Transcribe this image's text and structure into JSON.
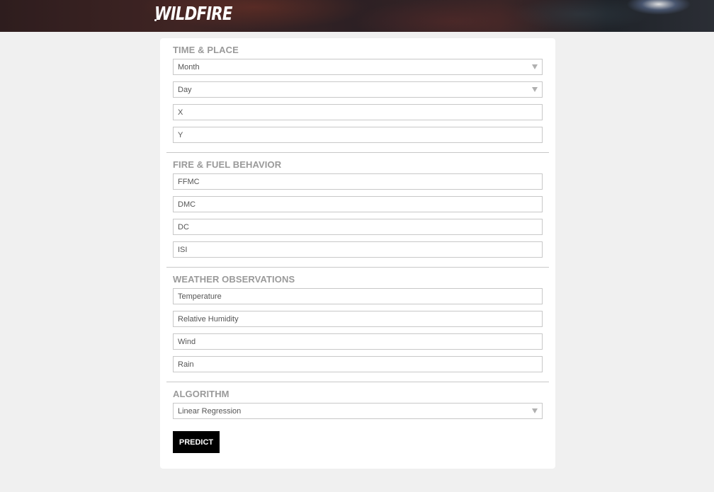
{
  "header": {
    "logo": "WILDFIRE"
  },
  "sections": {
    "time_place": {
      "title": "TIME & PLACE",
      "month": "Month",
      "day": "Day",
      "x": "X",
      "y": "Y"
    },
    "fire_fuel": {
      "title": "FIRE & FUEL BEHAVIOR",
      "ffmc": "FFMC",
      "dmc": "DMC",
      "dc": "DC",
      "isi": "ISI"
    },
    "weather": {
      "title": "WEATHER OBSERVATIONS",
      "temperature": "Temperature",
      "humidity": "Relative Humidity",
      "wind": "Wind",
      "rain": "Rain"
    },
    "algorithm": {
      "title": "ALGORITHM",
      "selected": "Linear Regression"
    }
  },
  "predict_label": "PREDICT",
  "colors": {
    "header_bg": "#2e1d1e",
    "page_bg": "#f0f0f0",
    "button": "#000000",
    "section_title": "#9a9a9a"
  },
  "icons": {
    "select_caret": "caret-down-icon"
  }
}
